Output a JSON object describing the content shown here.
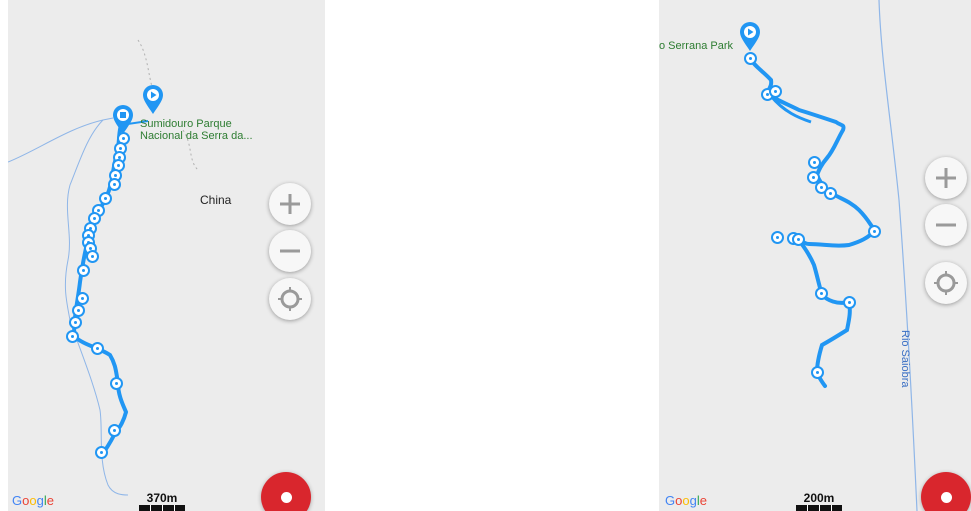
{
  "left_map": {
    "place_label": "Sumidouro Parque\nNacional da Serra da...",
    "town_label": "China",
    "scale_label": "370m",
    "google_logo": [
      "G",
      "o",
      "o",
      "g",
      "l",
      "e"
    ],
    "zoom_in_icon": "plus-icon",
    "zoom_out_icon": "minus-icon",
    "locate_icon": "locate-icon",
    "record_icon": "record-icon"
  },
  "right_map": {
    "place_label": "o Serrana Park",
    "river_label": "Rio Saiobra",
    "scale_label": "200m",
    "google_logo": [
      "G",
      "o",
      "o",
      "g",
      "l",
      "e"
    ],
    "zoom_in_icon": "plus-icon",
    "zoom_out_icon": "minus-icon",
    "locate_icon": "locate-icon",
    "record_icon": "record-icon"
  },
  "colors": {
    "track": "#2196f3",
    "pin": "#2196f3",
    "river": "#8fb6e8",
    "record": "#d9262d",
    "place_label": "#2e7d32",
    "google": [
      "#4285f4",
      "#ea4335",
      "#fbbc05",
      "#4285f4",
      "#34a853",
      "#ea4335"
    ]
  }
}
